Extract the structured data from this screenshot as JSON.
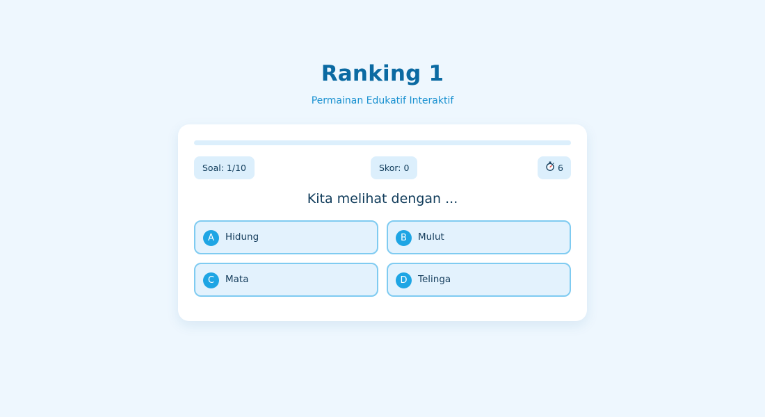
{
  "header": {
    "title": "Ranking 1",
    "subtitle": "Permainan Edukatif Interaktif"
  },
  "progress": {
    "fraction": 0.0
  },
  "stats": {
    "question_counter": "Soal: 1/10",
    "score": "Skor: 0",
    "timer_value": "6",
    "timer_icon": "stopwatch-icon"
  },
  "question": {
    "text": "Kita melihat dengan ..."
  },
  "options": [
    {
      "letter": "A",
      "text": "Hidung"
    },
    {
      "letter": "B",
      "text": "Mulut"
    },
    {
      "letter": "C",
      "text": "Mata"
    },
    {
      "letter": "D",
      "text": "Telinga"
    }
  ],
  "colors": {
    "background": "#eef7fe",
    "accent": "#1ea5e4",
    "title": "#0b6aa2",
    "option_border": "#7fcbf1",
    "option_bg": "#e3f2fd"
  }
}
